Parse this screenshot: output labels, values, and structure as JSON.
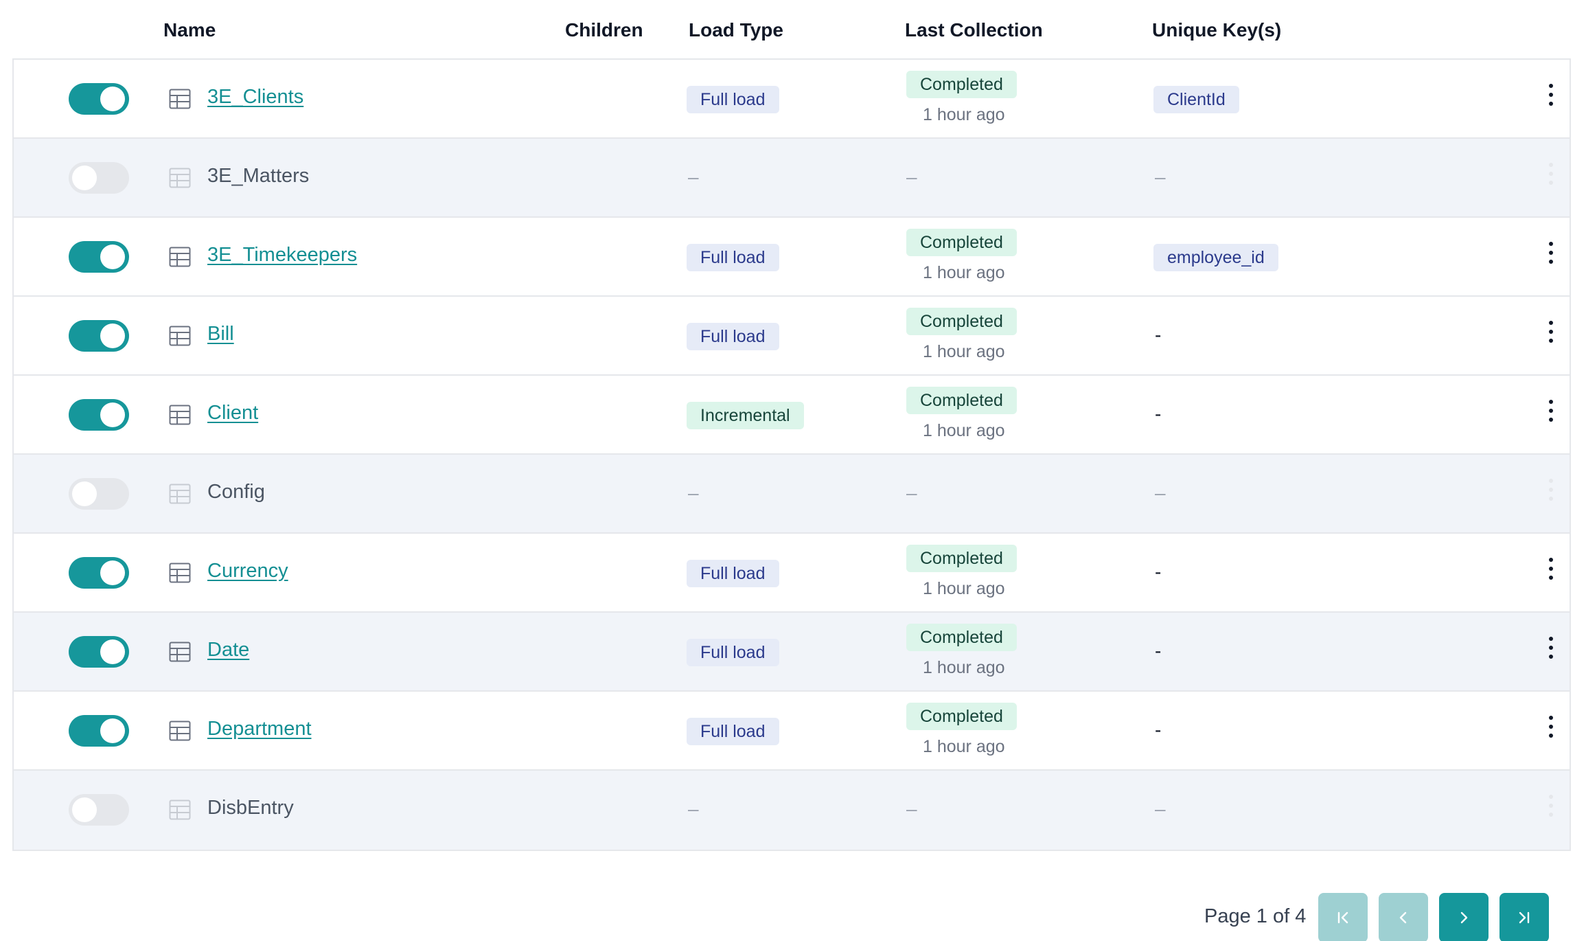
{
  "headers": {
    "name": "Name",
    "children": "Children",
    "load_type": "Load Type",
    "last_collection": "Last Collection",
    "unique_keys": "Unique Key(s)"
  },
  "rows": [
    {
      "name": "3E_Clients",
      "enabled": true,
      "load_type": "Full load",
      "status": "Completed",
      "ago": "1 hour ago",
      "key": "ClientId"
    },
    {
      "name": "3E_Matters",
      "enabled": false,
      "load_type": "–",
      "status": "–",
      "ago": "",
      "key": "–"
    },
    {
      "name": "3E_Timekeepers",
      "enabled": true,
      "load_type": "Full load",
      "status": "Completed",
      "ago": "1 hour ago",
      "key": "employee_id"
    },
    {
      "name": "Bill",
      "enabled": true,
      "load_type": "Full load",
      "status": "Completed",
      "ago": "1 hour ago",
      "key": "-"
    },
    {
      "name": "Client",
      "enabled": true,
      "load_type": "Incremental",
      "status": "Completed",
      "ago": "1 hour ago",
      "key": "-"
    },
    {
      "name": "Config",
      "enabled": false,
      "load_type": "–",
      "status": "–",
      "ago": "",
      "key": "–"
    },
    {
      "name": "Currency",
      "enabled": true,
      "load_type": "Full load",
      "status": "Completed",
      "ago": "1 hour ago",
      "key": "-"
    },
    {
      "name": "Date",
      "enabled": true,
      "load_type": "Full load",
      "status": "Completed",
      "ago": "1 hour ago",
      "key": "-"
    },
    {
      "name": "Department",
      "enabled": true,
      "load_type": "Full load",
      "status": "Completed",
      "ago": "1 hour ago",
      "key": "-"
    },
    {
      "name": "DisbEntry",
      "enabled": false,
      "load_type": "–",
      "status": "–",
      "ago": "",
      "key": "–"
    }
  ],
  "pagination": {
    "label": "Page 1 of 4",
    "first_icon": "first-page-icon",
    "prev_icon": "chevron-left-icon",
    "next_icon": "chevron-right-icon",
    "last_icon": "last-page-icon"
  },
  "colors": {
    "accent": "#16979b",
    "accent_disabled": "#9ed0d2",
    "row_disabled_bg": "#f1f4f9"
  }
}
